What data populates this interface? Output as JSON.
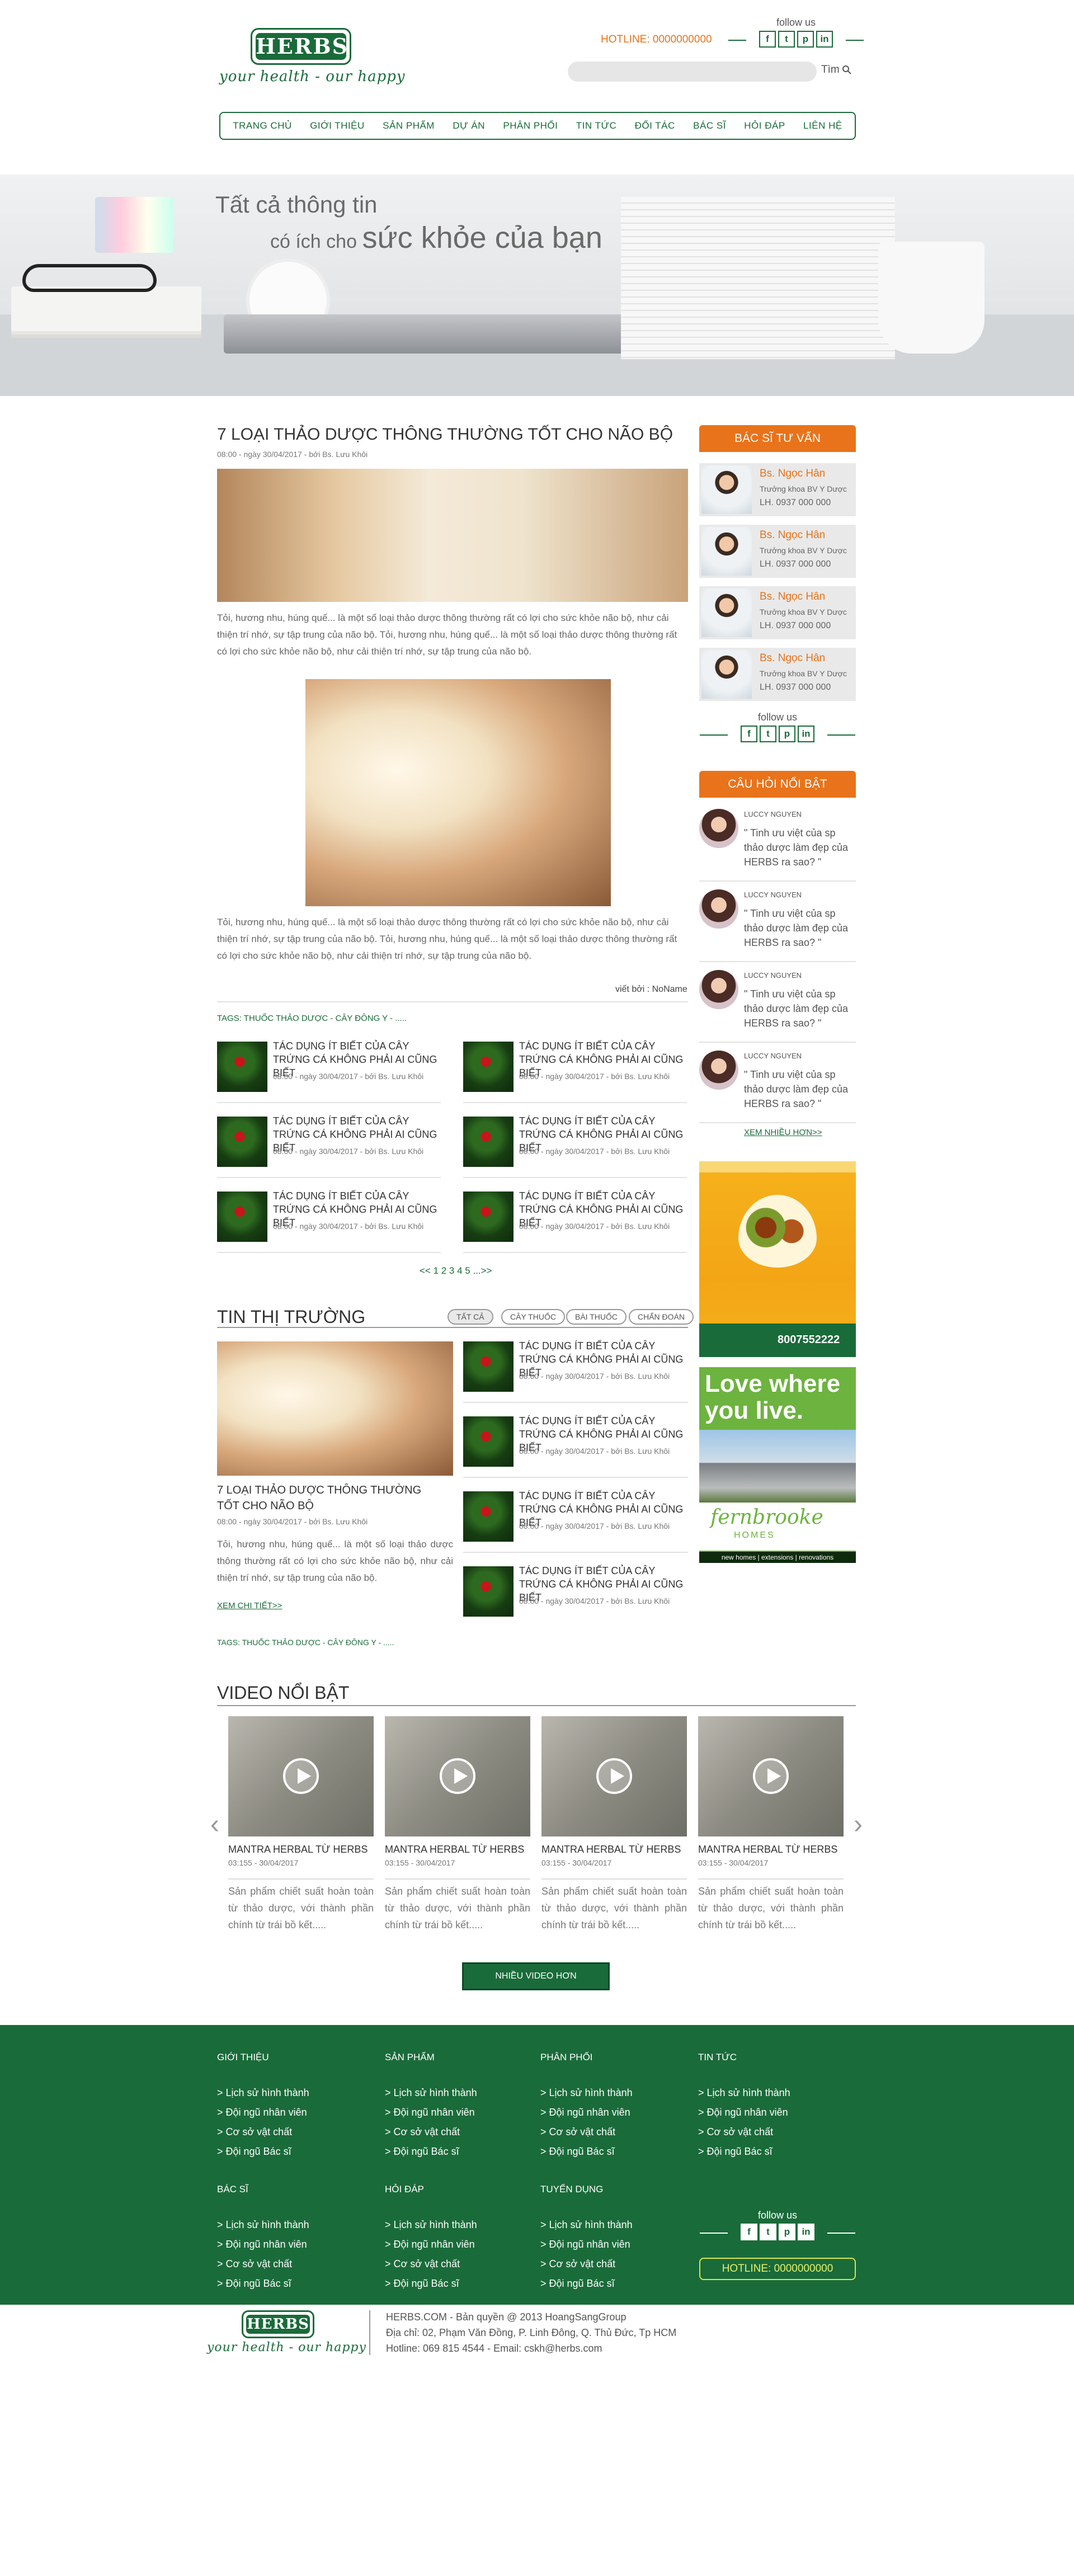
{
  "header": {
    "logo_text": "HERBS",
    "tagline": "your health - our happy",
    "follow_label": "follow us",
    "social": [
      "f",
      "t",
      "p",
      "in"
    ],
    "hotline": "HOTLINE: 0000000000",
    "search_button": "Tìm"
  },
  "nav": [
    "TRANG CHỦ",
    "GIỚI THIỆU",
    "SẢN PHẨM",
    "DỰ ÁN",
    "PHÂN PHỐI",
    "TIN TỨC",
    "ĐỐI TÁC",
    "BÁC SĨ",
    "HỎI ĐÁP",
    "LIÊN HỆ"
  ],
  "banner": {
    "line1": "Tất cả thông tin",
    "line2_small": "có ích cho",
    "line2_big": "sức khỏe của bạn"
  },
  "article": {
    "title": "7 LOẠI THẢO DƯỢC THÔNG THƯỜNG TỐT CHO NÃO BỘ",
    "meta": "08:00 - ngày 30/04/2017 - bởi Bs. Lưu Khôi",
    "para1": "Tỏi, hương nhu, húng quế... là một số loại thảo dược thông thường rất có lợi cho sức khỏe não bộ, như cải thiện trí nhớ, sự tập trung của não bộ. Tỏi, hương nhu, húng quế... là một số loại thảo dược thông thường rất có lợi cho sức khỏe não bộ, như cải thiện trí nhớ, sự tập trung của não bộ.",
    "para2": "Tỏi, hương nhu, húng quế... là một số loại thảo dược thông thường rất có lợi cho sức khỏe não bộ, như cải thiện trí nhớ, sự tập trung của não bộ. Tỏi, hương nhu, húng quế... là một số loại thảo dược thông thường rất có lợi cho sức khỏe não bộ, như cải thiện trí nhớ, sự tập trung của não bộ.",
    "author": "viết bởi : NoName",
    "tags": "TAGS: THUỐC THẢO DƯỢC - CÂY ĐÔNG Y - ....."
  },
  "related": {
    "title": "TÁC DỤNG ÍT BIẾT CỦA CÂY TRỨNG CÁ KHÔNG PHẢI AI CŨNG BIẾT",
    "meta": "08:00 - ngày 30/04/2017 - bởi Bs. Lưu Khôi"
  },
  "pagination": "<< 1 2 3 4 5 ...>>",
  "market": {
    "title": "TIN THỊ TRƯỜNG",
    "filters": [
      "TẤT CẢ",
      "CÂY THUỐC",
      "BÀI THUỐC",
      "CHẨN ĐOÁN"
    ],
    "main_title": "7 LOẠI THẢO DƯỢC THÔNG THƯỜNG TỐT CHO NÃO BỘ",
    "main_meta": "08:00 - ngày 30/04/2017 - bởi Bs. Lưu Khôi",
    "main_text": "Tỏi, hương nhu, húng quế... là một số loại thảo dược thông thường rất có lợi cho sức khỏe não bộ, như cải thiện trí nhớ, sự tập trung của não bộ.",
    "more": "XEM CHI TIẾT>>",
    "tags": "TAGS: THUỐC THẢO DƯỢC - CÂY ĐÔNG Y - ....."
  },
  "sidebar": {
    "doctors_title": "BÁC SĨ TƯ VẤN",
    "doctor": {
      "name": "Bs. Ngọc Hân",
      "desc": "Trưởng khoa BV Y Dược",
      "phone": "LH. 0937 000 000"
    },
    "follow_label": "follow us",
    "faq_title": "CÂU HỎI NỔI BẬT",
    "faq": {
      "name": "LUCCY NGUYEN",
      "text": "\" Tinh ưu việt của sp thảo dược làm đẹp của HERBS ra sao? \""
    },
    "faq_more": "XEM NHIỀU HƠN>>",
    "ad1_phone": "8007552222",
    "ad2_line1": "Love where",
    "ad2_line2": "you live.",
    "ad2_brand": "fernbrooke",
    "ad2_brand2": "HOMES",
    "ad2_footer": "new homes | extensions | renovations"
  },
  "videos": {
    "title": "VIDEO NỔI BẬT",
    "item_title": "MANTRA HERBAL TỪ HERBS",
    "item_meta": "03:155 - 30/04/2017",
    "item_desc": "Sản phẩm chiết suất hoàn toàn từ thảo dược, với thành phần chính từ trái bồ kết.....",
    "more_button": "NHIỀU VIDEO HƠN"
  },
  "footer": {
    "cols1": [
      {
        "heading": "GIỚI THIỆU"
      },
      {
        "heading": "SẢN PHẨM"
      },
      {
        "heading": "PHÂN PHỐI"
      },
      {
        "heading": "TIN TỨC"
      }
    ],
    "cols2": [
      {
        "heading": "BÁC SĨ"
      },
      {
        "heading": "HỎI ĐÁP"
      },
      {
        "heading": "TUYỂN DỤNG"
      }
    ],
    "items": [
      "> Lịch sử hình thành",
      "> Đội ngũ nhân viên",
      "> Cơ sở vật chất",
      "> Đội ngũ Bác sĩ"
    ],
    "follow_label": "follow us",
    "hotline": "HOTLINE: 0000000000"
  },
  "bottom": {
    "line1": "HERBS.COM - Bản quyền @ 2013 HoangSangGroup",
    "line2": "Địa chỉ: 02, Phạm Văn Đồng, P. Linh Đông, Q. Thủ Đức, Tp HCM",
    "line3": "Hotline: 069 815 4544 - Email: cskh@herbs.com"
  },
  "colors": {
    "brand_green": "#1a6b3a",
    "accent_orange": "#e8731a"
  }
}
